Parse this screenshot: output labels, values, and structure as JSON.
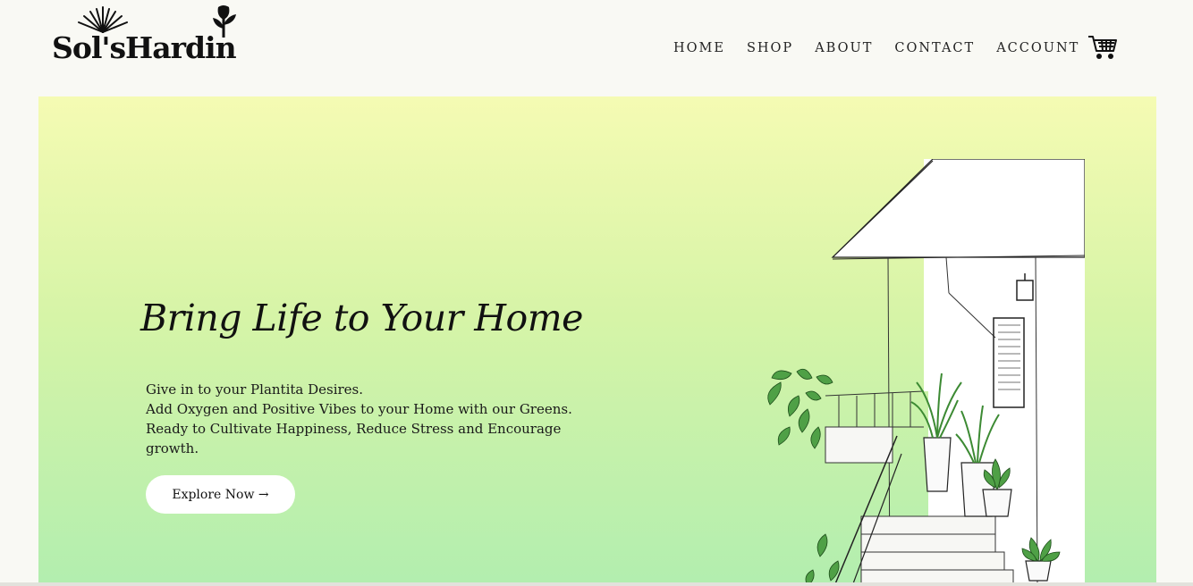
{
  "brand": {
    "logo_text": "Sol'sHardin"
  },
  "nav": {
    "items": [
      {
        "label": "HOME"
      },
      {
        "label": "SHOP"
      },
      {
        "label": "ABOUT"
      },
      {
        "label": "CONTACT"
      },
      {
        "label": "ACCOUNT"
      }
    ],
    "cart_icon": "shopping-cart-icon"
  },
  "hero": {
    "title": "Bring Life to Your Home",
    "lines": [
      "Give in to your Plantita Desires.",
      "Add Oxygen and Positive Vibes to your Home with our Greens.",
      "Ready to Cultivate Happiness, Reduce Stress and Encourage",
      "growth."
    ],
    "cta_label": "Explore Now →",
    "gradient": [
      "#f5fbb3",
      "#d6f4a7",
      "#b2eeaf"
    ],
    "illustration": "house-with-plants-sketch"
  },
  "colors": {
    "page_bg": "#f9f9f4",
    "text": "#111111",
    "button_bg": "#ffffff"
  }
}
